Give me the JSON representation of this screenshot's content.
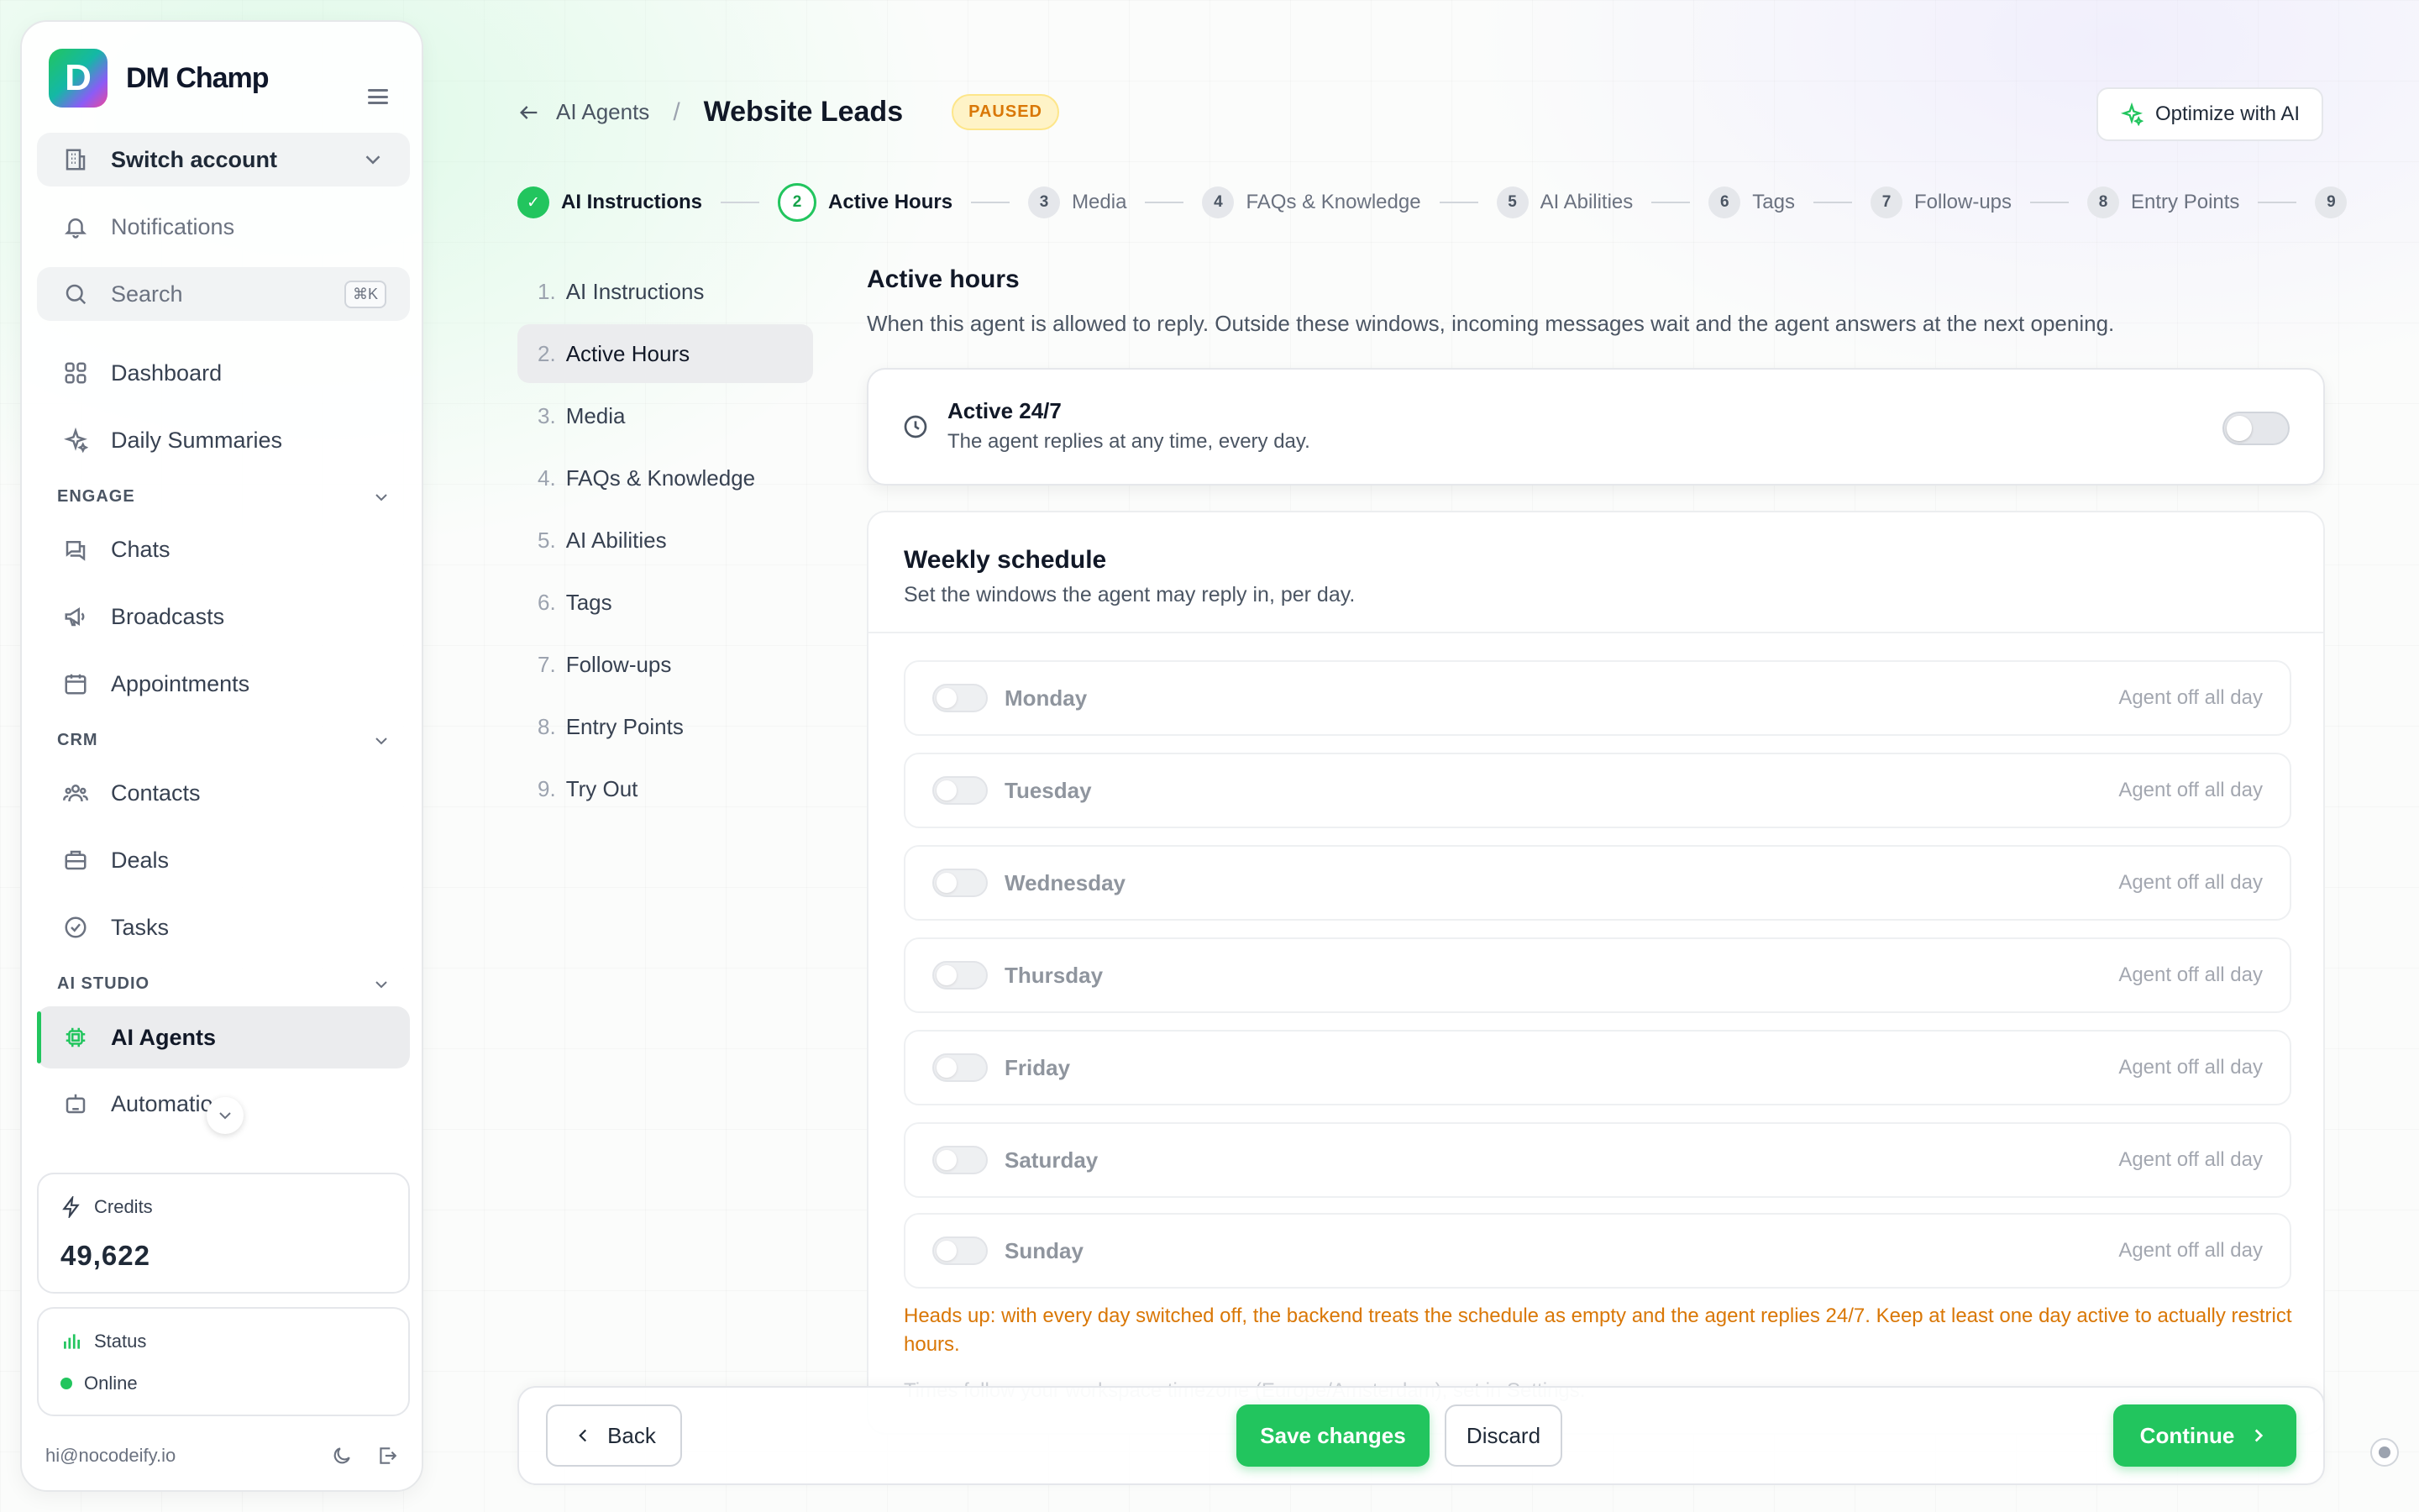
{
  "brand": {
    "name": "DM Champ",
    "logo_letter": "D"
  },
  "sidebar": {
    "switch_account": "Switch account",
    "notifications": "Notifications",
    "search": {
      "label": "Search",
      "shortcut": "⌘K"
    },
    "top_items": [
      {
        "label": "Dashboard",
        "icon": "grid-icon"
      },
      {
        "label": "Daily Summaries",
        "icon": "sparkles-icon"
      }
    ],
    "sections": [
      {
        "title": "ENGAGE",
        "items": [
          {
            "label": "Chats",
            "icon": "chat-icon"
          },
          {
            "label": "Broadcasts",
            "icon": "megaphone-icon"
          },
          {
            "label": "Appointments",
            "icon": "calendar-icon"
          }
        ]
      },
      {
        "title": "CRM",
        "items": [
          {
            "label": "Contacts",
            "icon": "users-icon"
          },
          {
            "label": "Deals",
            "icon": "briefcase-icon"
          },
          {
            "label": "Tasks",
            "icon": "check-circle-icon"
          }
        ]
      },
      {
        "title": "AI STUDIO",
        "items": [
          {
            "label": "AI Agents",
            "icon": "chip-icon"
          },
          {
            "label": "Automatio",
            "icon": "robot-icon"
          }
        ]
      }
    ],
    "credits": {
      "label": "Credits",
      "value": "49,622"
    },
    "status": {
      "label": "Status",
      "value": "Online"
    },
    "email": "hi@nocodeify.io"
  },
  "header": {
    "back_label": "AI Agents",
    "title": "Website Leads",
    "badge": "PAUSED",
    "optimize": "Optimize with AI"
  },
  "stepper": [
    {
      "num": "1",
      "label": "AI Instructions",
      "state": "done"
    },
    {
      "num": "2",
      "label": "Active Hours",
      "state": "current"
    },
    {
      "num": "3",
      "label": "Media",
      "state": "todo"
    },
    {
      "num": "4",
      "label": "FAQs & Knowledge",
      "state": "todo"
    },
    {
      "num": "5",
      "label": "AI Abilities",
      "state": "todo"
    },
    {
      "num": "6",
      "label": "Tags",
      "state": "todo"
    },
    {
      "num": "7",
      "label": "Follow-ups",
      "state": "todo"
    },
    {
      "num": "8",
      "label": "Entry Points",
      "state": "todo"
    },
    {
      "num": "9",
      "label": "",
      "state": "todo"
    }
  ],
  "subnav": [
    {
      "n": "1.",
      "label": "AI Instructions"
    },
    {
      "n": "2.",
      "label": "Active Hours",
      "active": true
    },
    {
      "n": "3.",
      "label": "Media"
    },
    {
      "n": "4.",
      "label": "FAQs & Knowledge"
    },
    {
      "n": "5.",
      "label": "AI Abilities"
    },
    {
      "n": "6.",
      "label": "Tags"
    },
    {
      "n": "7.",
      "label": "Follow-ups"
    },
    {
      "n": "8.",
      "label": "Entry Points"
    },
    {
      "n": "9.",
      "label": "Try Out"
    }
  ],
  "main": {
    "title": "Active hours",
    "description": "When this agent is allowed to reply. Outside these windows, incoming messages wait and the agent answers at the next opening.",
    "always_on": {
      "title": "Active 24/7",
      "desc": "The agent replies at any time, every day.",
      "enabled": false
    },
    "weekly": {
      "title": "Weekly schedule",
      "desc": "Set the windows the agent may reply in, per day.",
      "days": [
        {
          "name": "Monday",
          "status": "Agent off all day"
        },
        {
          "name": "Tuesday",
          "status": "Agent off all day"
        },
        {
          "name": "Wednesday",
          "status": "Agent off all day"
        },
        {
          "name": "Thursday",
          "status": "Agent off all day"
        },
        {
          "name": "Friday",
          "status": "Agent off all day"
        },
        {
          "name": "Saturday",
          "status": "Agent off all day"
        },
        {
          "name": "Sunday",
          "status": "Agent off all day"
        }
      ],
      "warning": "Heads up: with every day switched off, the backend treats the schedule as empty and the agent replies 24/7. Keep at least one day active to actually restrict hours.",
      "timezone_note": "Times follow your workspace timezone (Europe/Amsterdam), set in Settings."
    }
  },
  "footer": {
    "back": "Back",
    "save": "Save changes",
    "discard": "Discard",
    "continue": "Continue"
  },
  "colors": {
    "accent": "#22c55e",
    "warning": "#d97706",
    "badge_bg": "#fef3c7"
  }
}
